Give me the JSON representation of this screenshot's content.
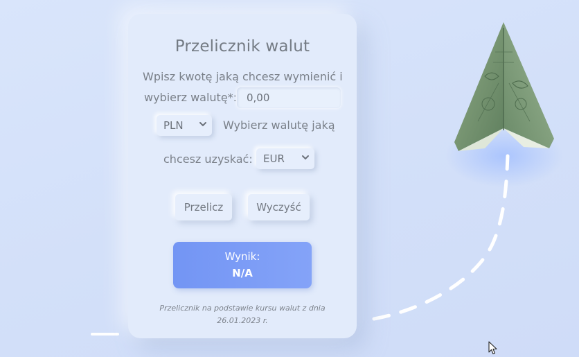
{
  "converter": {
    "title": "Przelicznik walut",
    "instruction_line1": "Wpisz kwotę jaką chcesz wymienić i",
    "instruction_line2": "wybierz walutę*:",
    "amount_value": "0,00",
    "from_currency": "PLN",
    "target_text_line1": "Wybierz walutę jaką",
    "target_text_line2": "chcesz uzyskać:",
    "to_currency": "EUR",
    "convert_button": "Przelicz",
    "clear_button": "Wyczyść",
    "result_label": "Wynik:",
    "result_value": "N/A",
    "footnote": "Przelicznik na podstawie kursu walut z dnia 26.01.2023 r."
  },
  "icons": {
    "select_arrow": "chevron-down-icon",
    "decoration": "paper-plane-banknote-icon",
    "pointer": "mouse-cursor-icon"
  },
  "colors": {
    "background": "#d6e2fa",
    "card": "#e2ebfb",
    "accent": "#7b9cf6",
    "text": "#747b84",
    "result_text": "#ffffff"
  }
}
